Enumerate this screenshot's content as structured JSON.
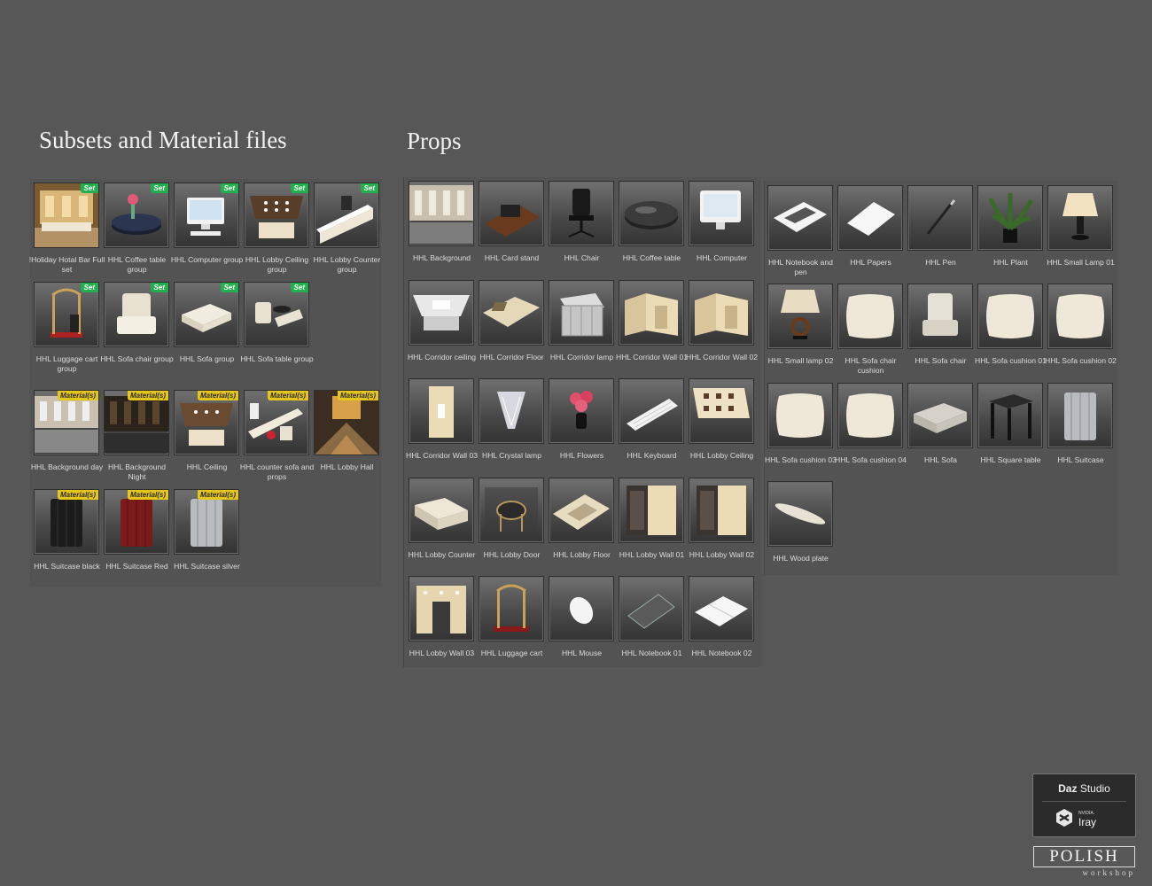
{
  "titles": {
    "subsets": "Subsets and Material files",
    "props": "Props"
  },
  "badges": {
    "set": "Set",
    "material": "Material(s)"
  },
  "subset_items": [
    {
      "label": "!Holiday Hotal Bar Full set",
      "badge": "set",
      "icon": "hotel-bar-scene-icon"
    },
    {
      "label": "HHL Coffee table group",
      "badge": "set",
      "icon": "coffee-table-group-icon"
    },
    {
      "label": "HHL Computer group",
      "badge": "set",
      "icon": "computer-group-icon"
    },
    {
      "label": "HHL Lobby Ceiling group",
      "badge": "set",
      "icon": "lobby-ceiling-group-icon"
    },
    {
      "label": "HHL Lobby Counter group",
      "badge": "set",
      "icon": "lobby-counter-group-icon"
    },
    {
      "label": "HHL Luggage cart group",
      "badge": "set",
      "icon": "luggage-cart-group-icon"
    },
    {
      "label": "HHL Sofa chair group",
      "badge": "set",
      "icon": "sofa-chair-group-icon"
    },
    {
      "label": "HHL Sofa group",
      "badge": "set",
      "icon": "sofa-group-icon"
    },
    {
      "label": "HHL Sofa table group",
      "badge": "set",
      "icon": "sofa-table-group-icon"
    }
  ],
  "material_items": [
    {
      "label": "HHL Background day",
      "badge": "material",
      "icon": "background-day-icon"
    },
    {
      "label": "HHL Background Night",
      "badge": "material",
      "icon": "background-night-icon"
    },
    {
      "label": "HHL Ceiling",
      "badge": "material",
      "icon": "ceiling-material-icon"
    },
    {
      "label": "HHL counter sofa and props",
      "badge": "material",
      "icon": "counter-sofa-props-icon"
    },
    {
      "label": "HHL Lobby Hall",
      "badge": "material",
      "icon": "lobby-hall-icon"
    },
    {
      "label": "HHL Suitcase black",
      "badge": "material",
      "icon": "suitcase-black-icon"
    },
    {
      "label": "HHL Suitcase Red",
      "badge": "material",
      "icon": "suitcase-red-icon"
    },
    {
      "label": "HHL Suitcase silver",
      "badge": "material",
      "icon": "suitcase-silver-icon"
    }
  ],
  "props_a": [
    {
      "label": "HHL Background",
      "icon": "background-icon"
    },
    {
      "label": "HHL Card stand",
      "icon": "card-stand-icon"
    },
    {
      "label": "HHL Chair",
      "icon": "chair-icon"
    },
    {
      "label": "HHL Coffee table",
      "icon": "coffee-table-icon"
    },
    {
      "label": "HHL Computer",
      "icon": "computer-icon"
    },
    {
      "label": "HHL Corridor ceiling",
      "icon": "corridor-ceiling-icon"
    },
    {
      "label": "HHL Corridor Floor",
      "icon": "corridor-floor-icon"
    },
    {
      "label": "HHL Corridor lamp",
      "icon": "corridor-lamp-icon"
    },
    {
      "label": "HHL Corridor Wall 01",
      "icon": "corridor-wall-icon"
    },
    {
      "label": "HHL Corridor Wall 02",
      "icon": "corridor-wall-icon"
    },
    {
      "label": "HHL Corridor Wall 03",
      "icon": "corridor-wall-panel-icon"
    },
    {
      "label": "HHL Crystal lamp",
      "icon": "crystal-lamp-icon"
    },
    {
      "label": "HHL Flowers",
      "icon": "flowers-icon"
    },
    {
      "label": "HHL Keyboard",
      "icon": "keyboard-icon"
    },
    {
      "label": "HHL Lobby Ceiling",
      "icon": "lobby-ceiling-icon"
    },
    {
      "label": "HHL Lobby Counter",
      "icon": "lobby-counter-icon"
    },
    {
      "label": "HHL Lobby Door",
      "icon": "lobby-door-icon"
    },
    {
      "label": "HHL Lobby Floor",
      "icon": "lobby-floor-icon"
    },
    {
      "label": "HHL Lobby Wall 01",
      "icon": "lobby-wall-icon"
    },
    {
      "label": "HHL Lobby Wall 02",
      "icon": "lobby-wall-icon"
    },
    {
      "label": "HHL Lobby Wall 03",
      "icon": "lobby-wall-door-icon"
    },
    {
      "label": "HHL Luggage cart",
      "icon": "luggage-cart-icon"
    },
    {
      "label": "HHL Mouse",
      "icon": "mouse-icon"
    },
    {
      "label": "HHL Notebook 01",
      "icon": "notebook-icon"
    },
    {
      "label": "HHL Notebook 02",
      "icon": "notebook-open-icon"
    }
  ],
  "props_b": [
    {
      "label": "HHL Notebook and pen",
      "icon": "notebook-pen-icon"
    },
    {
      "label": "HHL Papers",
      "icon": "papers-icon"
    },
    {
      "label": "HHL Pen",
      "icon": "pen-icon"
    },
    {
      "label": "HHL Plant",
      "icon": "plant-icon"
    },
    {
      "label": "HHL Small Lamp 01",
      "icon": "small-lamp-icon"
    },
    {
      "label": "HHL Small lamp 02",
      "icon": "small-lamp-ring-icon"
    },
    {
      "label": "HHL Sofa chair cushion",
      "icon": "cushion-icon"
    },
    {
      "label": "HHL Sofa chair",
      "icon": "sofa-chair-icon"
    },
    {
      "label": "HHL Sofa cushion 01",
      "icon": "cushion-icon"
    },
    {
      "label": "HHL Sofa cushion 02",
      "icon": "cushion-icon"
    },
    {
      "label": "HHL Sofa cushion 03",
      "icon": "cushion-icon"
    },
    {
      "label": "HHL Sofa cushion 04",
      "icon": "cushion-icon"
    },
    {
      "label": "HHL Sofa",
      "icon": "sofa-icon"
    },
    {
      "label": "HHL Square table",
      "icon": "square-table-icon"
    },
    {
      "label": "HHL Suitcase",
      "icon": "suitcase-silver-icon"
    },
    {
      "label": "HHL Wood plate",
      "icon": "wood-plate-icon"
    }
  ],
  "logos": {
    "daz_brand": "Daz",
    "daz_product": "Studio",
    "nvidia": "NVIDIA.",
    "iray": "Iray",
    "polish": "POLISH",
    "workshop": "workshop"
  },
  "colors": {
    "background": "#575757",
    "set_badge": "#21b04b",
    "material_badge": "#e6c619"
  }
}
